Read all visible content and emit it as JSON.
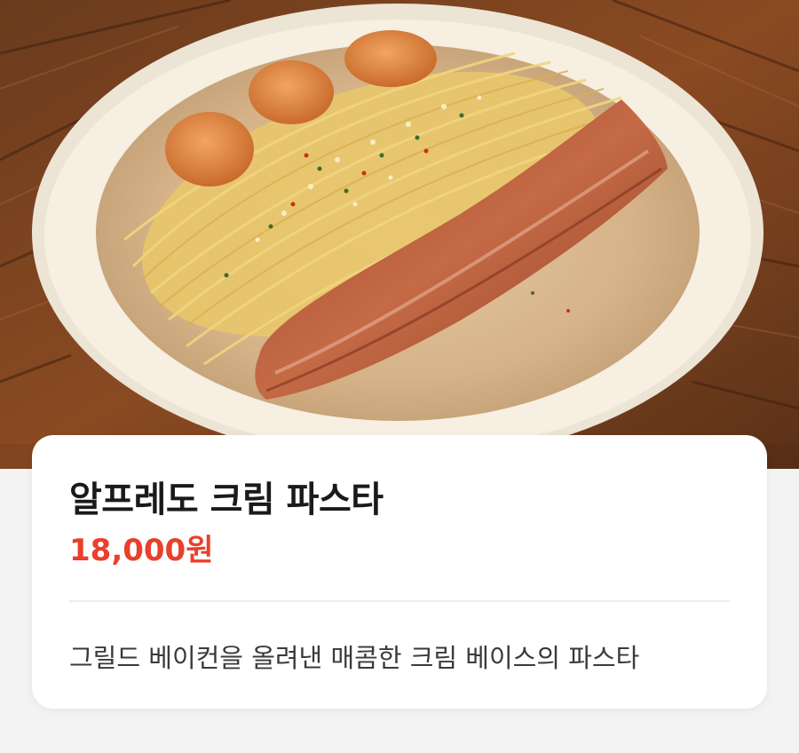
{
  "hero": {
    "image_icon": "pasta-photo"
  },
  "menu_item": {
    "name": "알프레도 크림 파스타",
    "price": "18,000원",
    "description": "그릴드 베이컨을 올려낸 매콤한 크림 베이스의 파스타"
  },
  "colors": {
    "price": "#ea3f2b",
    "title": "#1a1a1a",
    "background": "#f3f3f4"
  }
}
